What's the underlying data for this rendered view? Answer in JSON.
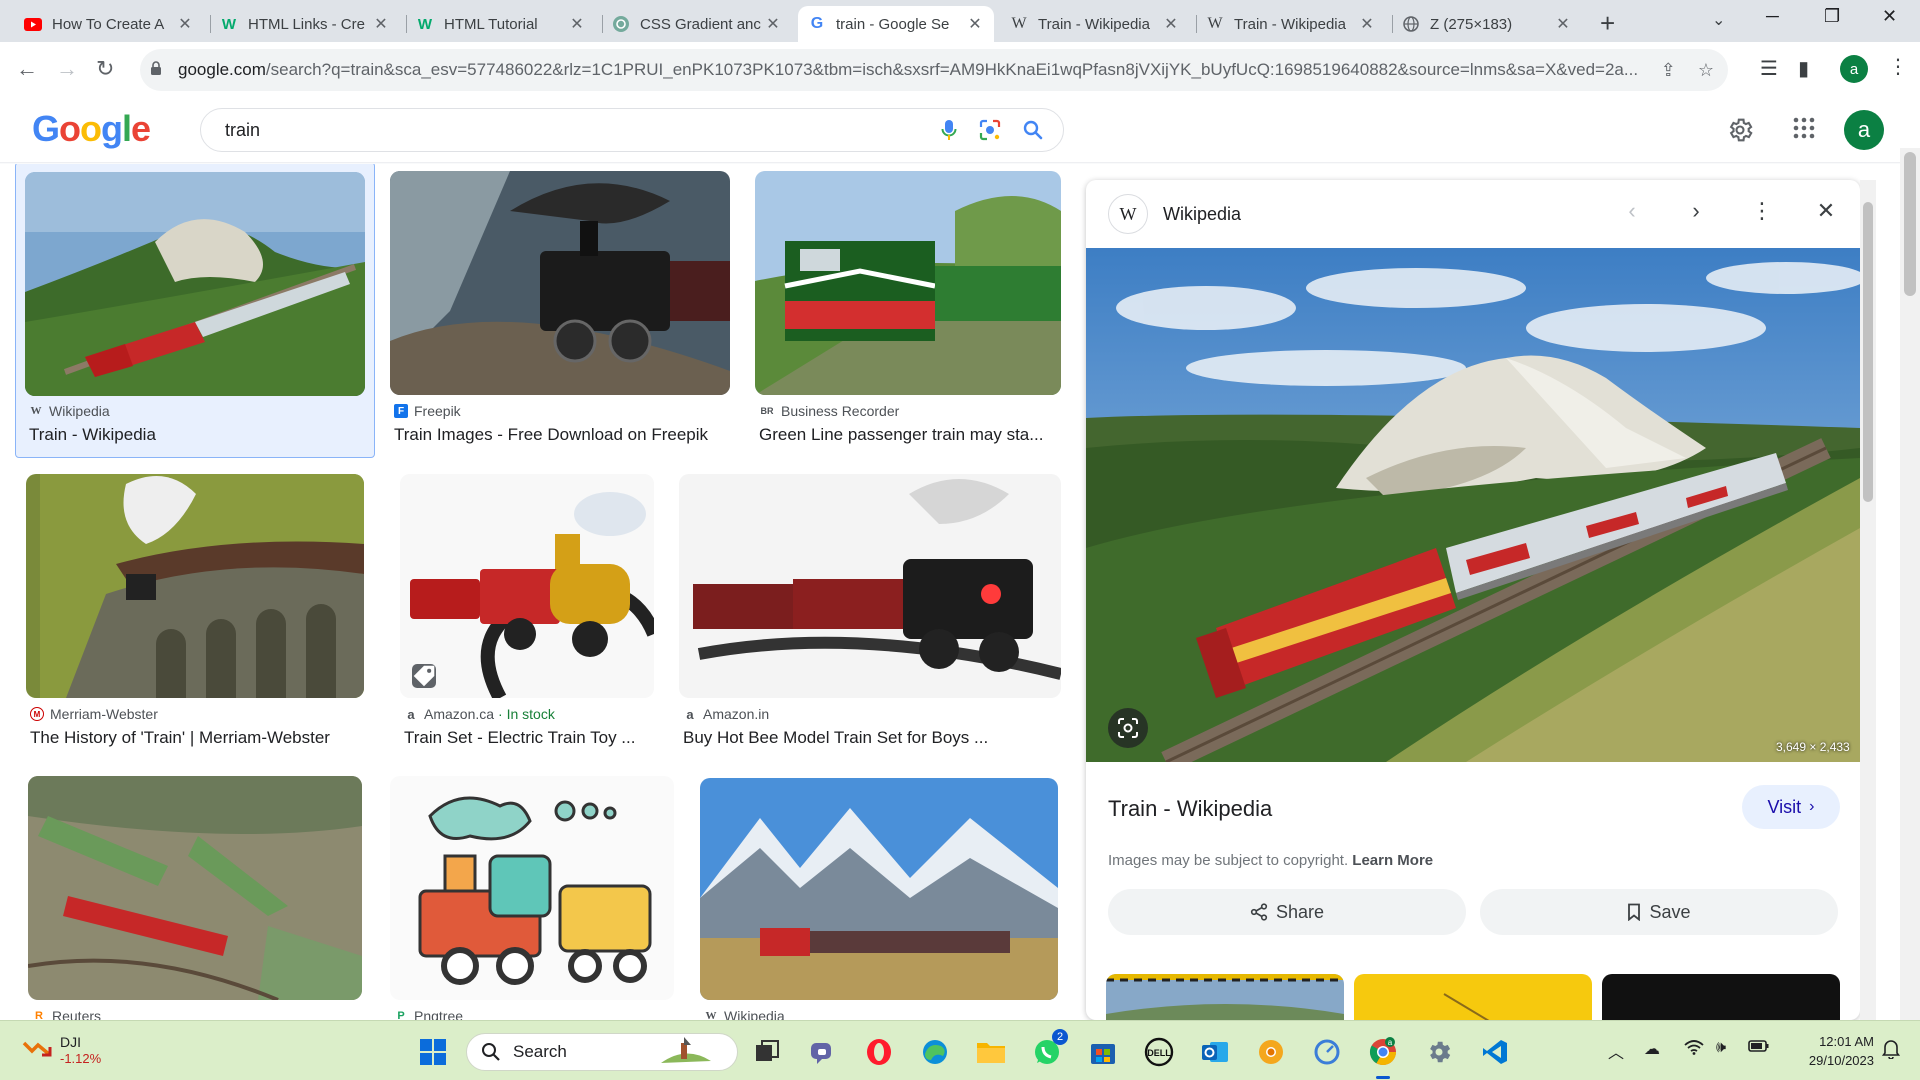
{
  "browser": {
    "tabs": [
      {
        "title": "How To Create A",
        "icon": "youtube-icon",
        "active": false
      },
      {
        "title": "HTML Links - Cre",
        "icon": "w3schools-icon",
        "active": false
      },
      {
        "title": "HTML Tutorial",
        "icon": "w3schools-icon",
        "active": false
      },
      {
        "title": "CSS Gradient anc",
        "icon": "openai-icon",
        "active": false
      },
      {
        "title": "train - Google Se",
        "icon": "google-icon",
        "active": true
      },
      {
        "title": "Train - Wikipedia",
        "icon": "wikipedia-icon",
        "active": false
      },
      {
        "title": "Train - Wikipedia",
        "icon": "wikipedia-icon",
        "active": false
      },
      {
        "title": "Z (275×183)",
        "icon": "globe-icon",
        "active": false
      }
    ],
    "url_host": "google.com",
    "url_rest": "/search?q=train&sca_esv=577486022&rlz=1C1PRUI_enPK1073PK1073&tbm=isch&sxsrf=AM9HkKnaEi1wqPfasn8jVXijYK_bUyfUcQ:1698519640882&source=lnms&sa=X&ved=2a...",
    "profile_initial": "a"
  },
  "google": {
    "logo": "Google",
    "query": "train",
    "avatar_initial": "a"
  },
  "results": [
    {
      "source": "Wikipedia",
      "favicon": "W",
      "stock": "",
      "caption": "Train - Wikipedia"
    },
    {
      "source": "Freepik",
      "favicon": "F",
      "stock": "",
      "caption": "Train Images - Free Download on Freepik"
    },
    {
      "source": "Business Recorder",
      "favicon": "BR",
      "stock": "",
      "caption": "Green Line passenger train may sta..."
    },
    {
      "source": "Merriam-Webster",
      "favicon": "M",
      "stock": "",
      "caption": "The History of 'Train' | Merriam-Webster"
    },
    {
      "source": "Amazon.ca",
      "favicon": "a",
      "stock": "· In stock",
      "caption": "Train Set - Electric Train Toy ..."
    },
    {
      "source": "Amazon.in",
      "favicon": "a",
      "stock": "",
      "caption": "Buy Hot Bee Model Train Set for Boys ..."
    },
    {
      "source": "Reuters",
      "favicon": "R",
      "stock": "",
      "caption": ""
    },
    {
      "source": "Pngtree",
      "favicon": "P",
      "stock": "",
      "caption": ""
    },
    {
      "source": "Wikipedia",
      "favicon": "W",
      "stock": "",
      "caption": ""
    }
  ],
  "preview": {
    "site": "Wikipedia",
    "site_favicon": "W",
    "dimensions": "3,649 × 2,433",
    "title": "Train - Wikipedia",
    "visit_label": "Visit",
    "copyright_text": "Images may be subject to copyright.",
    "learn_more": "Learn More",
    "share_label": "Share",
    "save_label": "Save"
  },
  "taskbar": {
    "weather_name": "DJI",
    "weather_value": "-1.12%",
    "search_label": "Search",
    "chat_badge": "2",
    "time": "12:01 AM",
    "date": "29/10/2023"
  },
  "colors": {
    "accent": "#1a73e8",
    "selected_bg": "#e8f0fe",
    "taskbar_bg": "#dbeec9",
    "stock_green": "#188038",
    "stock_down": "#c5221f"
  }
}
